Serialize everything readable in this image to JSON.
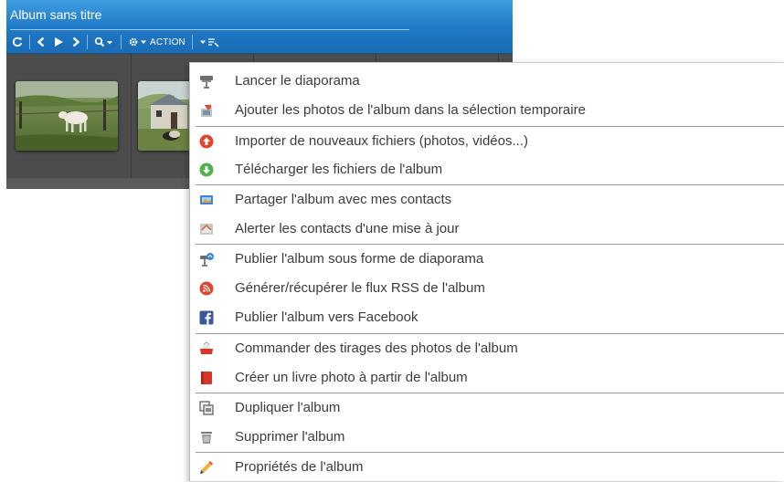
{
  "album": {
    "title": "Album sans titre",
    "toolbar": {
      "refresh_icon": "refresh-icon",
      "prev_icon": "chevron-left-icon",
      "play_icon": "play-icon",
      "next_icon": "chevron-right-icon",
      "search_icon": "magnifier-icon",
      "settings_icon": "gear-icon",
      "action_label": "ACTION",
      "sort_icon": "sort-filter-icon"
    },
    "thumbnails": [
      {
        "name": "cow-in-field-photo"
      },
      {
        "name": "farmhouse-photo"
      }
    ]
  },
  "menu": {
    "items": [
      {
        "label": "Lancer le diaporama",
        "icon": "projector-icon"
      },
      {
        "label": "Ajouter les photos de l'album dans la sélection temporaire",
        "icon": "add-to-selection-icon"
      },
      {
        "label": "Importer de nouveaux fichiers (photos, vidéos...)",
        "icon": "upload-icon"
      },
      {
        "label": "Télécharger les fichiers de l'album",
        "icon": "download-icon"
      },
      {
        "label": "Partager l'album avec mes contacts",
        "icon": "share-icon"
      },
      {
        "label": "Alerter les contacts d'une mise à jour",
        "icon": "alert-contacts-icon"
      },
      {
        "label": "Publier l'album sous forme de diaporama",
        "icon": "publish-slideshow-icon"
      },
      {
        "label": "Générer/récupérer le flux RSS de l'album",
        "icon": "rss-icon"
      },
      {
        "label": "Publier l'album vers Facebook",
        "icon": "facebook-icon"
      },
      {
        "label": "Commander des tirages des photos de l'album",
        "icon": "print-order-icon"
      },
      {
        "label": "Créer un livre photo à partir de l'album",
        "icon": "photo-book-icon"
      },
      {
        "label": "Dupliquer l'album",
        "icon": "duplicate-icon"
      },
      {
        "label": "Supprimer l'album",
        "icon": "trash-icon"
      },
      {
        "label": "Propriétés de l'album",
        "icon": "pencil-icon"
      }
    ]
  },
  "colors": {
    "titlebar": "#1f78c6",
    "menu_text": "#3c3c3c",
    "separator": "#9a9a9a"
  }
}
